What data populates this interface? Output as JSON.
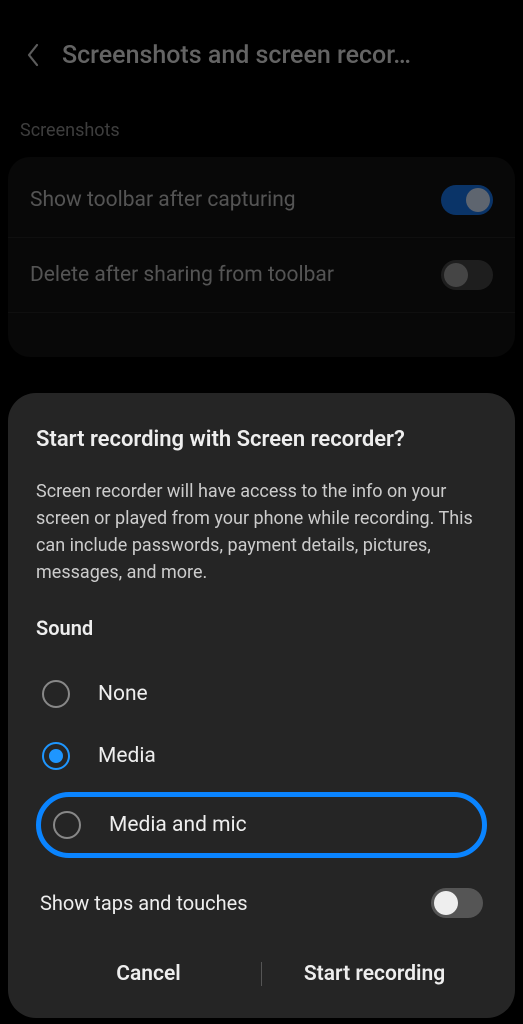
{
  "header": {
    "title": "Screenshots and screen recor…"
  },
  "section_label": "Screenshots",
  "settings": {
    "items": [
      {
        "label": "Show toolbar after capturing",
        "on": true
      },
      {
        "label": "Delete after sharing from toolbar",
        "on": false
      }
    ]
  },
  "dialog": {
    "title": "Start recording with Screen recorder?",
    "body": "Screen recorder will have access to the info on your screen or played from your phone while recording. This can include passwords, payment details, pictures, messages, and more.",
    "sound_label": "Sound",
    "options": [
      {
        "label": "None",
        "selected": false
      },
      {
        "label": "Media",
        "selected": true
      },
      {
        "label": "Media and mic",
        "selected": false,
        "highlighted": true
      }
    ],
    "show_taps_label": "Show taps and touches",
    "show_taps_on": false,
    "cancel_label": "Cancel",
    "start_label": "Start recording"
  }
}
